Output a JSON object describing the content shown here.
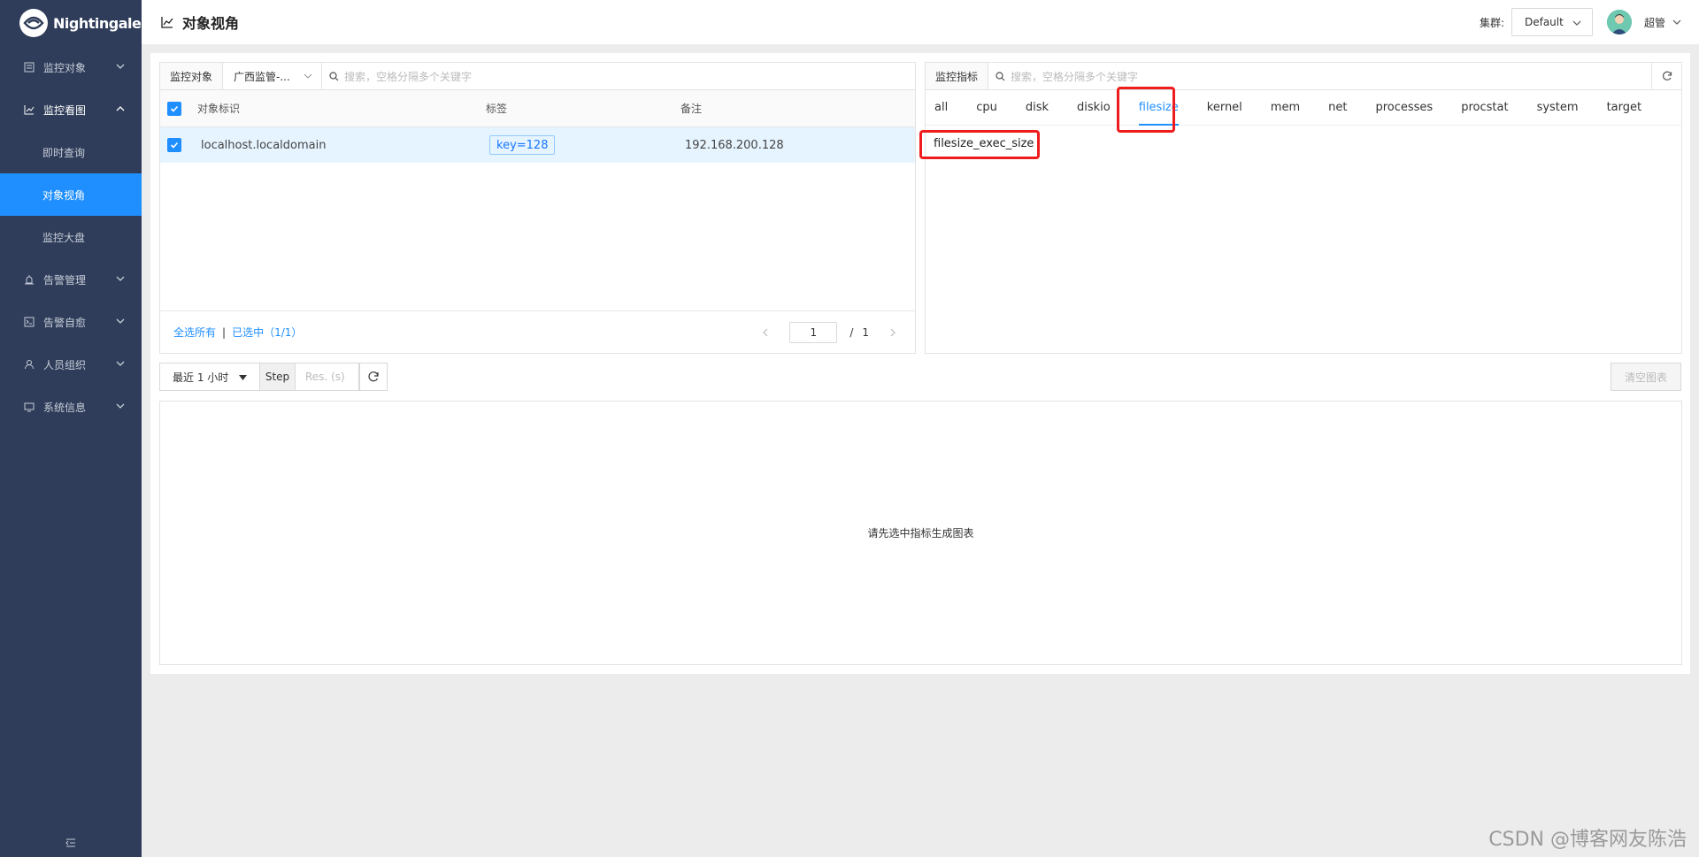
{
  "app": {
    "logo_text": "Nightingale"
  },
  "sidebar": {
    "items": [
      {
        "label": "监控对象",
        "icon": "list-icon"
      },
      {
        "label": "监控看图",
        "icon": "line-chart-icon",
        "open": true,
        "children": [
          {
            "label": "即时查询"
          },
          {
            "label": "对象视角",
            "active": true
          },
          {
            "label": "监控大盘"
          }
        ]
      },
      {
        "label": "告警管理",
        "icon": "alarm-icon"
      },
      {
        "label": "告警自愈",
        "icon": "terminal-icon"
      },
      {
        "label": "人员组织",
        "icon": "user-icon"
      },
      {
        "label": "系统信息",
        "icon": "monitor-icon"
      }
    ]
  },
  "header": {
    "title": "对象视角",
    "cluster_label": "集群:",
    "cluster_value": "Default",
    "user_name": "超管"
  },
  "left_panel": {
    "addon_label": "监控对象",
    "group_select": "广西监管-...",
    "search_placeholder": "搜索，空格分隔多个关键字",
    "columns": [
      "对象标识",
      "标签",
      "备注"
    ],
    "rows": [
      {
        "ident": "localhost.localdomain",
        "tag": "key=128",
        "note": "192.168.200.128",
        "checked": true
      }
    ],
    "footer": {
      "select_all": "全选所有",
      "separator": "|",
      "selected": "已选中（1/1）",
      "page_current": "1",
      "page_sep": "/",
      "page_total": "1"
    }
  },
  "right_panel": {
    "addon_label": "监控指标",
    "search_placeholder": "搜索，空格分隔多个关键字",
    "tabs": [
      "all",
      "cpu",
      "disk",
      "diskio",
      "filesize",
      "kernel",
      "mem",
      "net",
      "processes",
      "procstat",
      "system",
      "target"
    ],
    "active_tab": "filesize",
    "metrics": [
      "filesize_exec_size"
    ]
  },
  "chart_controls": {
    "time_range": "最近 1 小时",
    "step_label": "Step",
    "res_placeholder": "Res. (s)",
    "clear_button": "清空图表"
  },
  "chart_area": {
    "empty_text": "请先选中指标生成图表"
  },
  "colors": {
    "sidebar_bg": "#2f3d5a",
    "accent": "#1f8fff",
    "highlight": "#ee1c1c"
  },
  "watermark": "CSDN @博客网友陈浩"
}
